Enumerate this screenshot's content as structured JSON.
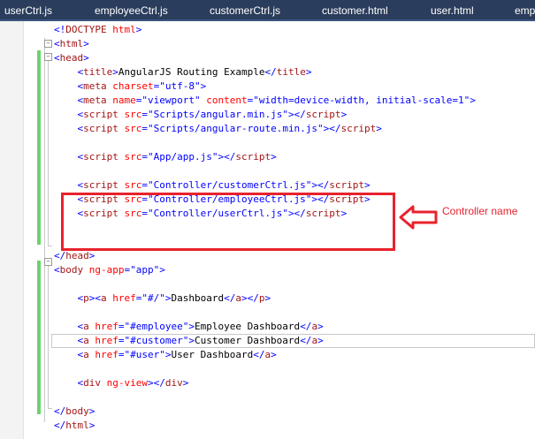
{
  "tabs": [
    "userCtrl.js",
    "employeeCtrl.js",
    "customerCtrl.js",
    "customer.html",
    "user.html",
    "emp"
  ],
  "editor": {
    "lines": [
      [
        [
          "b",
          "<!"
        ],
        [
          "t",
          "DOCTYPE"
        ],
        [
          "b",
          " "
        ],
        [
          "a",
          "html"
        ],
        [
          "b",
          ">"
        ]
      ],
      [
        [
          "b",
          "<"
        ],
        [
          "t",
          "html"
        ],
        [
          "b",
          ">"
        ]
      ],
      [
        [
          "b",
          "<"
        ],
        [
          "t",
          "head"
        ],
        [
          "b",
          ">"
        ]
      ],
      [
        [
          "b",
          "    <"
        ],
        [
          "t",
          "title"
        ],
        [
          "b",
          ">"
        ],
        [
          "x",
          "AngularJS Routing Example"
        ],
        [
          "b",
          "</"
        ],
        [
          "t",
          "title"
        ],
        [
          "b",
          ">"
        ]
      ],
      [
        [
          "b",
          "    <"
        ],
        [
          "t",
          "meta"
        ],
        [
          "b",
          " "
        ],
        [
          "a",
          "charset"
        ],
        [
          "b",
          "=\"utf-8\">"
        ]
      ],
      [
        [
          "b",
          "    <"
        ],
        [
          "t",
          "meta"
        ],
        [
          "b",
          " "
        ],
        [
          "a",
          "name"
        ],
        [
          "b",
          "=\"viewport\" "
        ],
        [
          "a",
          "content"
        ],
        [
          "b",
          "=\"width=device-width, initial-scale=1\">"
        ]
      ],
      [
        [
          "b",
          "    <"
        ],
        [
          "t",
          "script"
        ],
        [
          "b",
          " "
        ],
        [
          "a",
          "src"
        ],
        [
          "b",
          "=\"Scripts/angular.min.js\"></"
        ],
        [
          "t",
          "script"
        ],
        [
          "b",
          ">"
        ]
      ],
      [
        [
          "b",
          "    <"
        ],
        [
          "t",
          "script"
        ],
        [
          "b",
          " "
        ],
        [
          "a",
          "src"
        ],
        [
          "b",
          "=\"Scripts/angular-route.min.js\"></"
        ],
        [
          "t",
          "script"
        ],
        [
          "b",
          ">"
        ]
      ],
      [],
      [
        [
          "b",
          "    <"
        ],
        [
          "t",
          "script"
        ],
        [
          "b",
          " "
        ],
        [
          "a",
          "src"
        ],
        [
          "b",
          "=\"App/app.js\"></"
        ],
        [
          "t",
          "script"
        ],
        [
          "b",
          ">"
        ]
      ],
      [],
      [
        [
          "b",
          "    <"
        ],
        [
          "t",
          "script"
        ],
        [
          "b",
          " "
        ],
        [
          "a",
          "src"
        ],
        [
          "b",
          "=\"Controller/customerCtrl.js\"></"
        ],
        [
          "t",
          "script"
        ],
        [
          "b",
          ">"
        ]
      ],
      [
        [
          "b",
          "    <"
        ],
        [
          "t",
          "script"
        ],
        [
          "b",
          " "
        ],
        [
          "a",
          "src"
        ],
        [
          "b",
          "=\"Controller/employeeCtrl.js\"></"
        ],
        [
          "t",
          "script"
        ],
        [
          "b",
          ">"
        ]
      ],
      [
        [
          "b",
          "    <"
        ],
        [
          "t",
          "script"
        ],
        [
          "b",
          " "
        ],
        [
          "a",
          "src"
        ],
        [
          "b",
          "=\"Controller/userCtrl.js\"></"
        ],
        [
          "t",
          "script"
        ],
        [
          "b",
          ">"
        ]
      ],
      [],
      [],
      [
        [
          "b",
          "</"
        ],
        [
          "t",
          "head"
        ],
        [
          "b",
          ">"
        ]
      ],
      [
        [
          "b",
          "<"
        ],
        [
          "t",
          "body"
        ],
        [
          "b",
          " "
        ],
        [
          "a",
          "ng-app"
        ],
        [
          "b",
          "=\"app\">"
        ]
      ],
      [],
      [
        [
          "b",
          "    <"
        ],
        [
          "t",
          "p"
        ],
        [
          "b",
          "><"
        ],
        [
          "t",
          "a"
        ],
        [
          "b",
          " "
        ],
        [
          "a",
          "href"
        ],
        [
          "b",
          "=\"#/\">"
        ],
        [
          "x",
          "Dashboard"
        ],
        [
          "b",
          "</"
        ],
        [
          "t",
          "a"
        ],
        [
          "b",
          "></"
        ],
        [
          "t",
          "p"
        ],
        [
          "b",
          ">"
        ]
      ],
      [],
      [
        [
          "b",
          "    <"
        ],
        [
          "t",
          "a"
        ],
        [
          "b",
          " "
        ],
        [
          "a",
          "href"
        ],
        [
          "b",
          "=\"#employee\">"
        ],
        [
          "x",
          "Employee Dashboard"
        ],
        [
          "b",
          "</"
        ],
        [
          "t",
          "a"
        ],
        [
          "b",
          ">"
        ]
      ],
      [
        [
          "b",
          "    <"
        ],
        [
          "t",
          "a"
        ],
        [
          "b",
          " "
        ],
        [
          "a",
          "href"
        ],
        [
          "b",
          "=\"#customer\">"
        ],
        [
          "x",
          "Customer Dashboard"
        ],
        [
          "b",
          "</"
        ],
        [
          "t",
          "a"
        ],
        [
          "b",
          ">"
        ]
      ],
      [
        [
          "b",
          "    <"
        ],
        [
          "t",
          "a"
        ],
        [
          "b",
          " "
        ],
        [
          "a",
          "href"
        ],
        [
          "b",
          "=\"#user\">"
        ],
        [
          "x",
          "User Dashboard"
        ],
        [
          "b",
          "</"
        ],
        [
          "t",
          "a"
        ],
        [
          "b",
          ">"
        ]
      ],
      [],
      [
        [
          "b",
          "    <"
        ],
        [
          "t",
          "div"
        ],
        [
          "b",
          " "
        ],
        [
          "a",
          "ng-view"
        ],
        [
          "b",
          "></"
        ],
        [
          "t",
          "div"
        ],
        [
          "b",
          ">"
        ]
      ],
      [],
      [
        [
          "b",
          "</"
        ],
        [
          "t",
          "body"
        ],
        [
          "b",
          ">"
        ]
      ],
      [
        [
          "b",
          "</"
        ],
        [
          "t",
          "html"
        ],
        [
          "b",
          ">"
        ]
      ]
    ],
    "current_line": 22,
    "colors": {
      "tag": "#a31515",
      "attr": "#ff0000",
      "punct": "#0000ff",
      "text": "#000000",
      "change_bar": "#6cd36c",
      "tab_bg": "#2b3d5c"
    }
  },
  "annotation": {
    "label": "Controller name",
    "color": "#e8222d",
    "arrow": "left-arrow-icon"
  }
}
